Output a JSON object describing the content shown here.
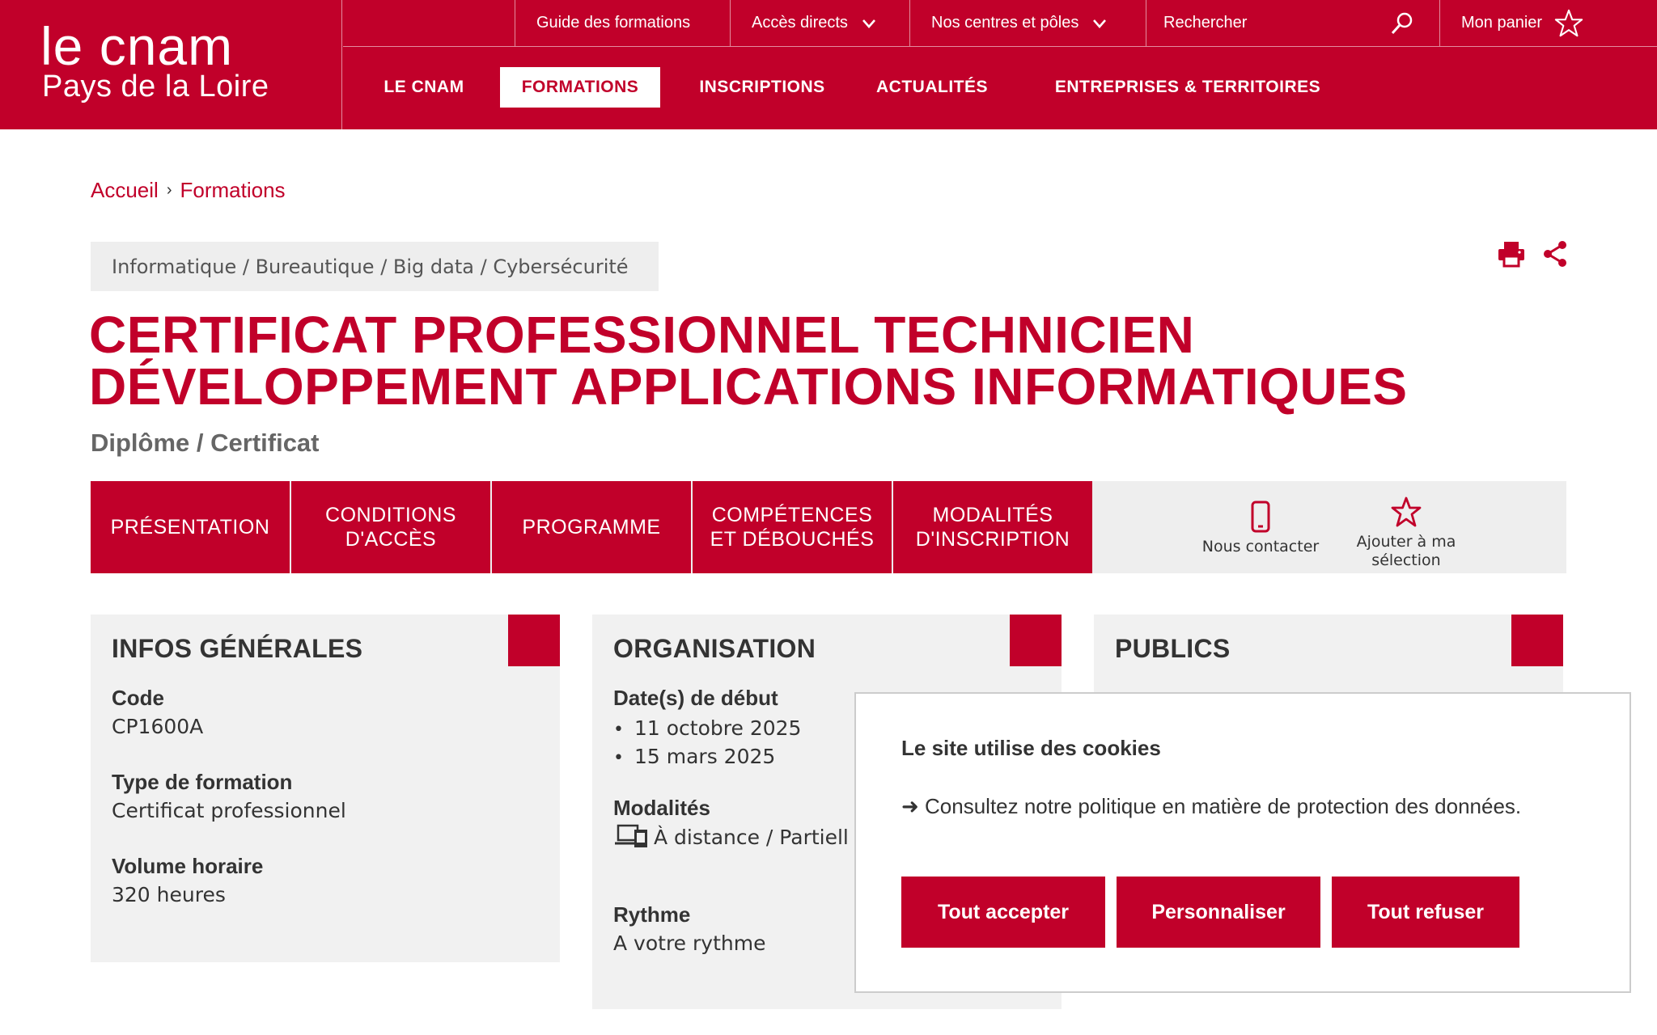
{
  "brand": {
    "logo_line1": "le cnam",
    "logo_line2": "Pays de la Loire",
    "primary_color": "#c1002a"
  },
  "topbar": {
    "guide": "Guide des formations",
    "acces": "Accès directs",
    "centres": "Nos centres et pôles",
    "search_placeholder": "Rechercher",
    "cart": "Mon panier"
  },
  "mainnav": {
    "items": [
      "LE CNAM",
      "FORMATIONS",
      "INSCRIPTIONS",
      "ACTUALITÉS",
      "ENTREPRISES & TERRITOIRES"
    ],
    "active": "FORMATIONS"
  },
  "breadcrumb": {
    "home": "Accueil",
    "separator": "›",
    "current": "Formations"
  },
  "category_tag": "Informatique / Bureautique / Big data / Cybersécurité",
  "title": {
    "line1": "CERTIFICAT PROFESSIONNEL TECHNICIEN",
    "line2": "DÉVELOPPEMENT APPLICATIONS INFORMATIQUES",
    "subtitle": "Diplôme / Certificat"
  },
  "tabs": [
    "PRÉSENTATION",
    "CONDITIONS D'ACCÈS",
    "PROGRAMME",
    "COMPÉTENCES ET DÉBOUCHÉS",
    "MODALITÉS D'INSCRIPTION"
  ],
  "tab_actions": {
    "contact": "Nous contacter",
    "selection": "Ajouter à ma sélection"
  },
  "infos": {
    "heading": "INFOS GÉNÉRALES",
    "code_label": "Code",
    "code_value": "CP1600A",
    "type_label": "Type de formation",
    "type_value": "Certificat professionnel",
    "volume_label": "Volume horaire",
    "volume_value": "320 heures"
  },
  "organisation": {
    "heading": "ORGANISATION",
    "dates_label": "Date(s) de début",
    "dates": [
      "11 octobre 2025",
      "15 mars 2025"
    ],
    "modalites_label": "Modalités",
    "modalites_value": "À distance / Partiell",
    "rythme_label": "Rythme",
    "rythme_value": "A votre rythme"
  },
  "publics": {
    "heading": "PUBLICS"
  },
  "cookie": {
    "title": "Le site utilise des cookies",
    "text": "➜ Consultez notre politique en matière de protection des données.",
    "accept": "Tout accepter",
    "customize": "Personnaliser",
    "refuse": "Tout refuser"
  }
}
